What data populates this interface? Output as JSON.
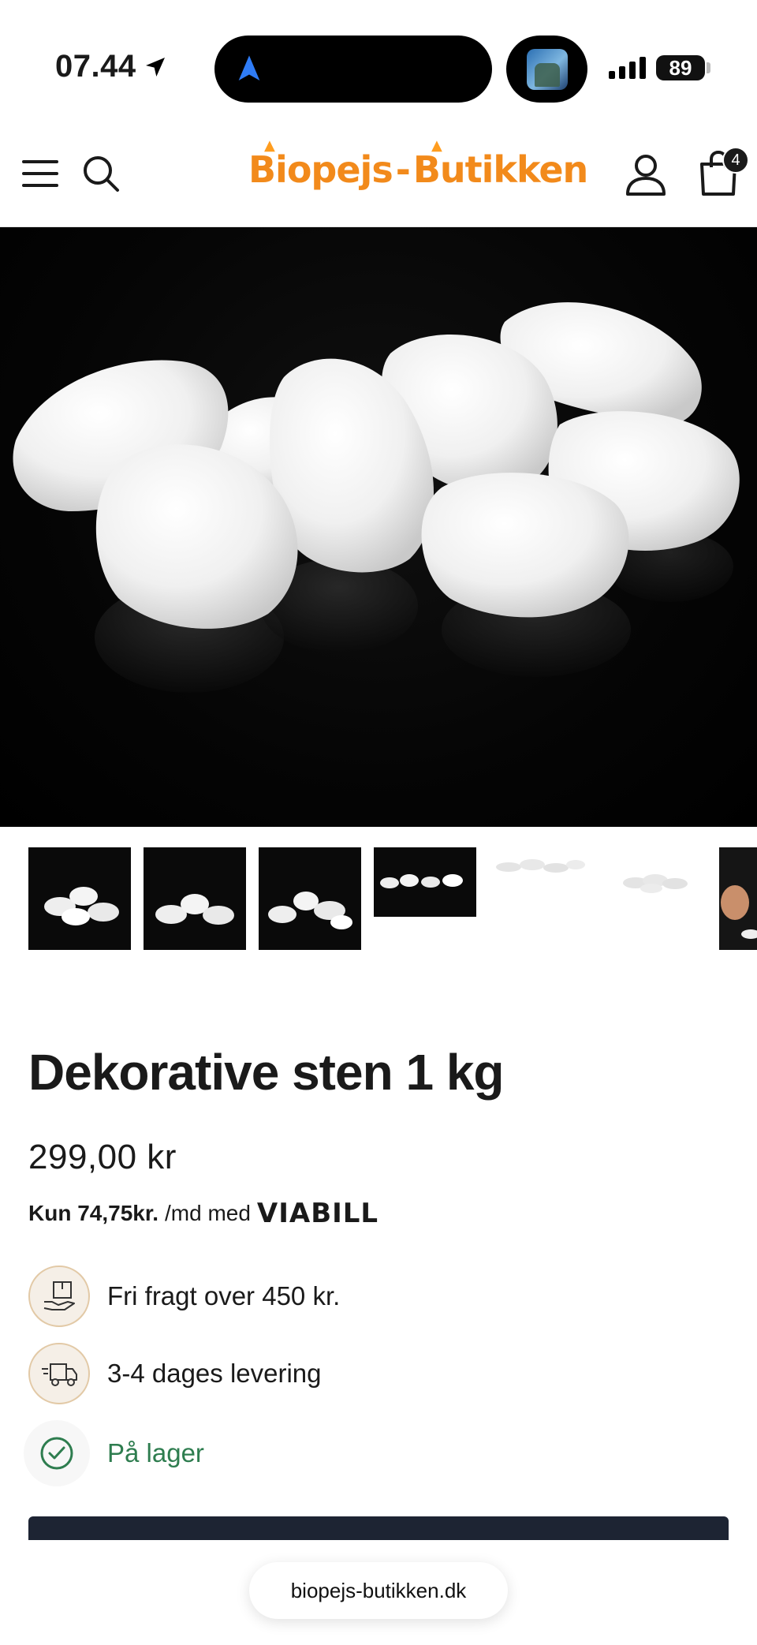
{
  "status_bar": {
    "time": "07.44",
    "battery": "89",
    "icons": [
      "location-arrow-icon",
      "navigation-icon",
      "signal-icon",
      "battery-icon"
    ]
  },
  "header": {
    "logo_text_left": "Biopejs",
    "logo_dash": "-",
    "logo_text_right": "Butikken",
    "cart_count": "4",
    "icons": [
      "menu-icon",
      "search-icon",
      "account-icon",
      "shopping-bag-icon"
    ]
  },
  "product": {
    "title": "Dekorative sten 1 kg",
    "price": "299,00 kr",
    "installment_strong": "Kun 74,75kr.",
    "installment_rest": "/md med",
    "installment_brand": "VIABILL",
    "thumbnail_count": 7
  },
  "info": {
    "shipping": "Fri fragt over 450 kr.",
    "delivery": "3-4 dages levering",
    "stock": "På lager"
  },
  "browser": {
    "url": "biopejs-butikken.dk"
  },
  "colors": {
    "brand_orange": "#f28a1b",
    "stock_green": "#2e7d4f",
    "cta_navy": "#1d2433",
    "icon_ring": "#e2c9a6"
  }
}
